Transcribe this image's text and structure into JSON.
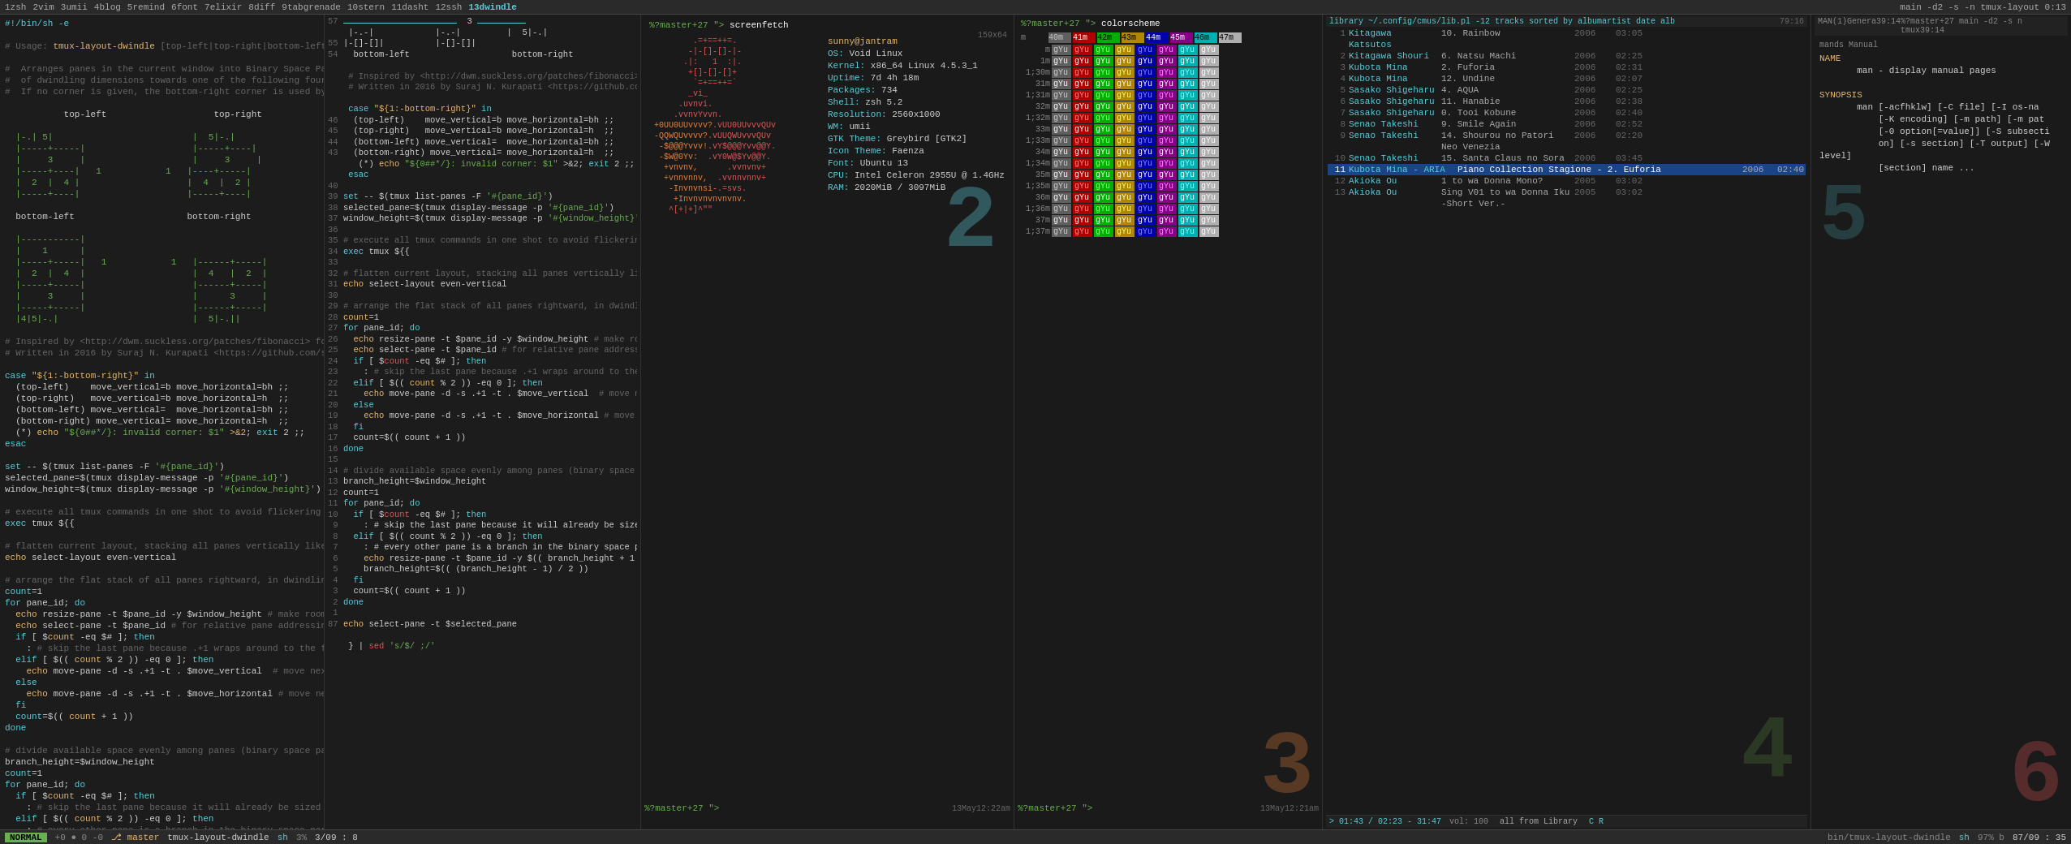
{
  "topbar": {
    "items": [
      "1zsh",
      "2vim",
      "3umii",
      "4blog",
      "5remind",
      "6font",
      "7elixir",
      "8diff",
      "9tabgrenade",
      "10stern",
      "11dasht",
      "12ssh",
      "13dwindle"
    ],
    "active": "13dwindle",
    "right": "main -d2 -s -n tmux-layout  0:13"
  },
  "pane1": {
    "title": "tmux-layout-dwindle",
    "content_lines": [
      "#!/bin/sh -e",
      "",
      "# Usage: tmux-layout-dwindle [top-left|top-right|bottom-left|bottom-right]",
      "",
      "# Arranges panes in the current window into Binary Space Partitions",
      "# of dwindling dimensions towards one of the following four corners.",
      "# If no corner is given, the bottom-right corner is used by default.",
      "",
      "    top-left                          top-right",
      "",
      "  |-.| 5|                          |  5|-.|",
      "  |----+-----|                    |-----+----|",
      "  |    3     |                    |    3     |",
      "  |-----+----|   1            1   |----+-----|",
      "  |  2  |  4 |                    |  4  |  2 |",
      "  |-----+----|                    |-----+----|",
      "  |    1     |",
      "  |-----------.",
      "",
      "  bottom-left                     bottom-right",
      "",
      "  |-----------|",
      "  |    1      |",
      "  |-----+-----|   1            1   |------+-----|",
      "  |  2  |  4  |                    |  4   |  2  |",
      "  |-----+-----|                    |------+-----|",
      "  |    3      |                    |     3      |",
      "  |-----+-----|                    |------+-----|",
      "  | 4 5 |                          |  5|-.||",
      "",
      "# Inspired by <http://dwm.suckless.org/patches/fibonacci> for dwm.",
      "# Written in 2016 by Suraj N. Kurapati <https://github.com/sunaku>",
      "",
      "case \"${1:-bottom-right}\" in",
      "  (top-left)    move_vertical=b move_horizontal=bh ;;",
      "  (top-right)   move_vertical=b move_horizontal=h  ;;",
      "  (bottom-left) move_vertical=  move_horizontal=bh ;;",
      "  (bottom-right) move_vertical= move_horizontal=h  ;;",
      "  (*) echo \"${0##*/}: invalid corner: $1\" >&2; exit 2 ;;",
      "esac",
      "",
      "set -- $(tmux list-panes -F '#{pane_id}')",
      "selected_pane=$(tmux display-message -p '#{pane_id}')",
      "window_height=$(tmux display-message -p '#{window_height}')",
      "",
      "# execute all tmux commands in one shot to avoid flickering and slowness",
      "exec tmux ${{",
      "",
      "# flatten current layout, stacking all panes vertically like pancakes",
      "echo select-layout even-vertical",
      "",
      "# arrange the flat stack of all panes rightward, in dwindling fashion",
      "count=1",
      "for pane_id; do",
      "  echo resize-pane -t $pane_id -y $window_height # make room for move",
      "  echo select-pane -t $pane_id # for relative pane addressing in move",
      "  if [ $(count -eq $1 ]; then",
      "    : # skip the last pane because .+1 wraps around to the first pane",
      "  elif [ $(( count % 2 )) -eq 0 ]; then",
      "    echo move-pane -d -s .+1 -t . $move_vertical  # move next pane",
      "  else",
      "    echo move-pane -d -s .+1 -t . $move_horizontal # move next pane",
      "  fi",
      "  count=$(( count + 1 ))",
      "done",
      "",
      "# divide available space evenly among panes (binary space partitions)",
      "branch_height=$window_height",
      "count=1",
      "for pane_id; do",
      "  if [ $count -eq $# ]; then",
      "    : # skip the last pane because it will already be sized correctly",
      "  elif [ $(( count % 2 )) -eq 0 ]; then",
      "    : # every other pane is a branch in the binary space partition tree",
      "    echo resize-pane -t $pane_id -y $(( branch_height + 1 ) / 2 ))",
      "    branch_height=$(( (branch_height - 1) / 2 ))",
      "  fi",
      "  count=$(( count + 1 ))",
      "done",
      "",
      "# restore pane selection back to how it was before we did any of this",
      "echo select-pane -t $selected_pane",
      "",
      "} | sed 's/$/ ;/'"
    ]
  },
  "pane2": {
    "content_lines": [
      "#!/bin/sh -e",
      "",
      "# Usage: tmux-layout-dwindle [top-left|top-right|bottom-left|bottom-right]",
      "",
      "# Arranges panes in the current window into Binary Space Partitions",
      "# of dwindling dimensions towards one of the following four corners.",
      "# If no corner is given, the bottom-right corner is used by default.",
      "",
      "case \"${1:-bottom-right}\" in",
      "  (top-left)    move_vertical=b move_horizontal=bh ;;",
      "  (top-right)   move_vertical=b move_horizontal=h  ;;",
      "  (bottom-left) move_vertical=  move_horizontal=bh ;;",
      "  (bottom-right) move_vertical= move_horizontal=h  ;;",
      "  (*) echo \"${0##*/}: invalid corner: $1\" >&2; exit 2 ;;",
      "esac",
      "",
      "set -- $(tmux list-panes -F '#{pane_id}')",
      "selected_pane=$(tmux display-message -p '#{pane_id}')",
      "window_height=$(tmux display-message -p '#{window_height}')",
      "",
      "# execute all tmux commands in one shot to avoid flickering and slowness",
      "exec tmux ${{",
      "",
      "# flatten current layout, stacking all panes vertically like pancakes",
      "echo select-layout even-vertical",
      "",
      "# arrange the flat stack of all panes rightward, in dwindling fashion",
      "count=1",
      "for pane_id; do",
      "  echo resize-pane -t $pane_id -y $window_height # make room for move",
      "  echo select-pane -t $pane_id # for relative pane addressing in move",
      "  if [ $count -eq $# ]; then",
      "    : # skip the last pane because .+1 wraps around to the first pane",
      "  elif [ $(( count % 2 )) -eq 0 ]; then",
      "    echo move-pane -d -s .+1 -t . $move_vertical  # move next pane",
      "  else",
      "    echo move-pane -d -s .+1 -t . $move_horizontal # move next pane",
      "  fi",
      "  count=$(( count + 1 ))",
      "done",
      "",
      "# divide available space evenly among panes (binary space partitions)",
      "branch_height=$window_height",
      "count=1",
      "for pane_id; do",
      "  if [ $count -eq $# ]; then",
      "    : # skip the last pane because it will already be sized correctly",
      "  elif [ $(( count % 2 )) -eq 0 ]; then",
      "    : # every other pane is a branch in the binary space partition tree",
      "    echo resize-pane -t $pane_id -y $(( branch_height + 1 ) / 2 ))",
      "    branch_height=$(( (branch_height - 1) / 2 ))",
      "  fi",
      "  count=$(( count + 1 ))",
      "done",
      "",
      "# restore pane selection back to how it was before we did any of this",
      "echo select-pane -t $selected_pane",
      "",
      "} | sed 's/$/ ;/'"
    ],
    "line_start": 57
  },
  "pane3": {
    "prompt": "%?master+27 \"> screenfetch",
    "art_lines": [
      "          .=+==++=.",
      "         -|-[]-[]-|",
      "        .|:   1  :|.",
      "         +[]-[]-[]+ ",
      "          `=+==++=`",
      "         _vi_",
      "       .uvnvi.",
      "      .vvnvYvvn.",
      "+0UU0UUvvvv? .vUU0UUvvvQUv",
      " -QQWQUvvvv? .vUUQWUvvvQUv",
      "  -$@@@Yvvv!.vY$@@@Yvv@@Y.",
      "  -$W@0Yv:  .vY0W@$Yv@@Y.",
      "   +vnvnv,      .vvnvnv+",
      "   +vnnvnnv,  .vvnnvnnv+",
      "    -Invnvnsi-.=svs.",
      "     +Invnvnvnvnvnv.",
      "    ^[+|+]^\""
    ],
    "info": {
      "user": "sunny@jantram",
      "os": "OS: Void Linux",
      "kernel": "Kernel: x86_64 Linux 4.5.3_1",
      "uptime": "Uptime: 7d 4h 18m",
      "packages": "Packages: 734",
      "shell": "Shell: zsh 5.2",
      "resolution": "Resolution: 2560x1000",
      "wm": "WM: umii",
      "gtk_theme": "GTK Theme: Greybird [GTK2]",
      "icon_theme": "Icon Theme: Faenza",
      "font": "Font: Ubuntu 13",
      "cpu": "CPU: Intel Celeron 2955U @ 1.4GHz",
      "ram": "RAM: 2020MiB / 3097MiB"
    },
    "prompt2": "%?master+27 \">",
    "timestamp": "13May12:22am",
    "size": "159x64"
  },
  "pane4": {
    "prompt": "%?master+27 \"> colorscheme",
    "timestamp": "13May12:21am",
    "prompt2": "%?master+27 \">",
    "colors": {
      "m": [
        "#5f5f5f",
        "#af0000",
        "#00af00",
        "#af8700",
        "#0000af",
        "#870087",
        "#00afaf",
        "#afafaf"
      ],
      "1m": [
        "#8a8a8a",
        "#ff0000",
        "#00ff00",
        "#ffff00",
        "#0000ff",
        "#ff00ff",
        "#00ffff",
        "#ffffff"
      ],
      "bar_labels": [
        "m",
        "1m",
        "1;30m",
        "31m",
        "1;31m",
        "32m",
        "1;32m",
        "33m",
        "1;33m",
        "34m",
        "1;34m",
        "35m",
        "1;35m",
        "36m",
        "1;36m",
        "37m",
        "1;37m"
      ],
      "color_sets": [
        {
          "label": "40m",
          "bg": "#5f5f5f"
        },
        {
          "label": "41m",
          "bg": "#af0000"
        },
        {
          "label": "42m",
          "bg": "#00af00"
        },
        {
          "label": "43m",
          "bg": "#af8700"
        },
        {
          "label": "44m",
          "bg": "#0000af"
        },
        {
          "label": "45m",
          "bg": "#870087"
        },
        {
          "label": "46m",
          "bg": "#00afaf"
        },
        {
          "label": "47m",
          "bg": "#afafaf"
        }
      ]
    }
  },
  "pane5": {
    "title": "library ~/.config/cmus/lib.pl -12 tracks sorted by albumartist date alb",
    "header_right": "79:16",
    "tracks": [
      {
        "num": "1",
        "artist": "Kitagawa Katsutos",
        "title": "10. Rainbow",
        "year": "2006",
        "dur": "03:05"
      },
      {
        "num": "2",
        "artist": "Kitagawa Shouri",
        "title": "6. Natsu Machi",
        "year": "2006",
        "dur": "02:25"
      },
      {
        "num": "3",
        "artist": "Kubota Mina",
        "title": "2. Fuforia",
        "year": "2006",
        "dur": "02:31"
      },
      {
        "num": "4",
        "artist": "Kubota Mina",
        "title": "12. Undine",
        "year": "2006",
        "dur": "02:07"
      },
      {
        "num": "5",
        "artist": "Sasako Shigeharu",
        "title": "4. AQUA",
        "year": "2006",
        "dur": "02:25"
      },
      {
        "num": "6",
        "artist": "Sasako Shigeharu",
        "title": "11. Hanabie",
        "year": "2006",
        "dur": "02:38"
      },
      {
        "num": "7",
        "artist": "Sasako Shigeharu",
        "title": "0. Tooi Kobune",
        "year": "2006",
        "dur": "02:40"
      },
      {
        "num": "8",
        "artist": "Senao Takeshi",
        "title": "9. Smile Again",
        "year": "2006",
        "dur": "02:52"
      },
      {
        "num": "9",
        "artist": "Senao Takeshi",
        "title": "14. Shourou no Patori Neo Venezia",
        "year": "2006",
        "dur": "02:20"
      },
      {
        "num": "10",
        "artist": "Senao Takeshi",
        "title": "15. Santa Claus no Sora",
        "year": "2006",
        "dur": "03:45"
      },
      {
        "num": "11",
        "artist": "Kubota Mina - ARIA",
        "title": "Piano Collection Stagione - 2. Euforia",
        "year": "2006",
        "dur": "02:40",
        "highlight": true
      },
      {
        "num": "12",
        "artist": "Akioka Ou",
        "title": "1 to wa Donna Mono?",
        "year": "2005",
        "dur": "03:02"
      },
      {
        "num": "13",
        "artist": "Akioka Ou",
        "title": "Sing V01 to wa Donna Iku -Short Ver.",
        "year": "2005",
        "dur": "03:02"
      }
    ],
    "player": {
      "time_current": "01:43",
      "time_total": "02:23",
      "time_all": "31:47",
      "volume": "vol: 100",
      "source": "all from Library",
      "controls": "C R"
    }
  },
  "pane6": {
    "command": "man",
    "section": "1",
    "title": "Genera39:14",
    "prompt_right": "%?master+27 main -d2 -s n tmux39:14",
    "note": "mands Manual",
    "content": [
      "NAME",
      "       man - display manual pages",
      "",
      "SYNOPSIS",
      "       man [-acfhklw] [-C file] [-M os-na",
      "           [-K encoding] [-m path] [-m pat",
      "           [-0 option[=value]] [-S subsecti",
      "           on] [-s section] [-T output] [-W level]",
      "           [section] name ..."
    ]
  },
  "statusbar": {
    "mode": "NORMAL",
    "git": "+0 0 -0",
    "branch": "master",
    "filename": "tmux-layout-dwindle",
    "filetype": "sh",
    "percent": "3%",
    "position": "3/09",
    "col": "8",
    "right_pane": "bin/tmux-layout-dwindle",
    "right_percent": "97% b",
    "right_pos": "87/09",
    "right_col": "35"
  }
}
